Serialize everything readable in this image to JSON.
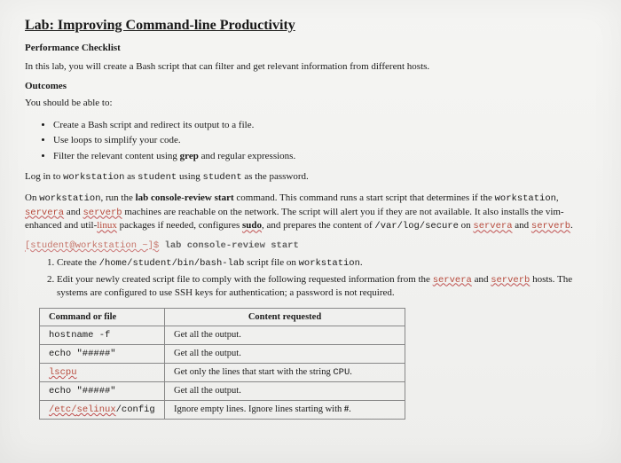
{
  "title": "Lab: Improving Command-line Productivity",
  "checklist_heading": "Performance Checklist",
  "intro": "In this lab, you will create a Bash script that can filter and get relevant information from different hosts.",
  "outcomes_heading": "Outcomes",
  "outcomes_intro": "You should be able to:",
  "bullets": [
    "Create a Bash script and redirect its output to a file.",
    "Use loops to simplify your code."
  ],
  "bullet3_pre": "Filter the relevant content using ",
  "bullet3_bold": "grep",
  "bullet3_post": " and regular expressions.",
  "login_pre": "Log in to ",
  "login_ws": "workstation",
  "login_mid": " as ",
  "login_user": "student",
  "login_mid2": " using ",
  "login_pw": "student",
  "login_post": " as the password.",
  "p2_pre": "On ",
  "p2_ws": "workstation",
  "p2_a": ", run the ",
  "p2_cmd": "lab console-review start",
  "p2_b": " command. This command runs a start script that determines if the ",
  "p2_ws2": "workstation",
  "p2_c": ", ",
  "p2_sa": "servera",
  "p2_d": " and ",
  "p2_sb": "serverb",
  "p2_e": " machines are reachable on the network. The script will alert you if they are not available. It also installs the vim-enhanced and util-",
  "p2_linux": "linux",
  "p2_f": " packages if needed, configures ",
  "p2_sudo": "sudo",
  "p2_g": ", and prepares the content of ",
  "p2_path": "/var/log/secure",
  "p2_h": " on ",
  "p2_sa2": "servera",
  "p2_i": " and ",
  "p2_sb2": "serverb",
  "p2_j": ".",
  "term_prompt": "[student@workstation ~]$",
  "term_cmd": " lab console-review start",
  "step1_a": "Create the ",
  "step1_path": "/home/student/bin/bash-lab",
  "step1_b": " script file on ",
  "step1_ws": "workstation",
  "step1_c": ".",
  "step2_a": "Edit your newly created script file to comply with the following requested information from the ",
  "step2_sa": "servera",
  "step2_b": " and ",
  "step2_sb": "serverb",
  "step2_c": " hosts. The systems are configured to use SSH keys for authentication; a password is not required.",
  "table": {
    "h1": "Command or file",
    "h2": "Content requested",
    "rows": [
      {
        "cmd": "hostname -f",
        "cmd_class": "",
        "content": "Get all the output."
      },
      {
        "cmd": "echo \"#####\"",
        "cmd_class": "",
        "content": "Get all the output."
      },
      {
        "cmd": "lscpu",
        "cmd_class": "red wavy",
        "content_pre": "Get only the lines that start with the string ",
        "content_mono": "CPU",
        "content_post": "."
      },
      {
        "cmd": "echo \"#####\"",
        "cmd_class": "",
        "content": "Get all the output."
      },
      {
        "cmd_pre": "/etc/",
        "cmd_mid": "selinux",
        "cmd_post": "/config",
        "cmd_class": "red wavy",
        "content_pre": "Ignore empty lines. Ignore lines starting with ",
        "content_bold": "#",
        "content_post": "."
      }
    ]
  }
}
